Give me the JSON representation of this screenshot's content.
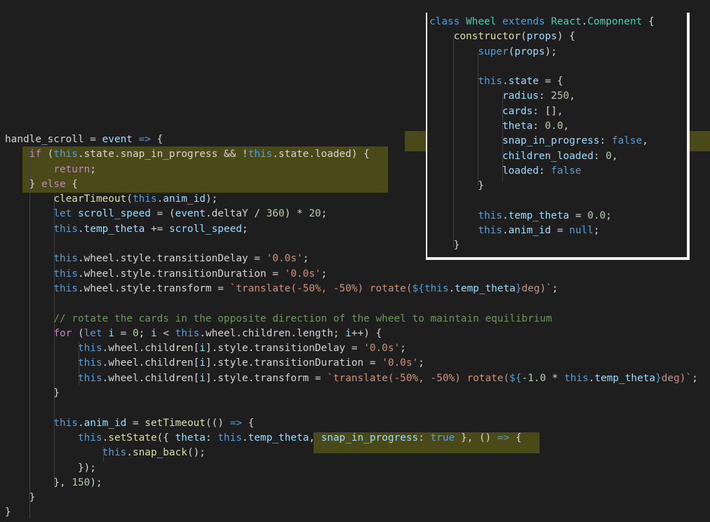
{
  "colors": {
    "background": "#1e1e1e",
    "highlight": "#707014",
    "keyword": "#569cd6",
    "control": "#c586c0",
    "type": "#4ec9b0",
    "function": "#dcdcaa",
    "variable": "#9cdcfe",
    "string": "#ce9178",
    "number": "#b5cea8",
    "comment": "#6a9955",
    "text": "#d4d4d4"
  },
  "main_code": {
    "lines": [
      [
        [
          "p",
          "handle_scroll"
        ],
        [
          "p",
          " = "
        ],
        [
          "v",
          "event"
        ],
        [
          "p",
          " "
        ],
        [
          "k",
          "=>"
        ],
        [
          "p",
          " {"
        ]
      ],
      [
        [
          "p",
          "    "
        ],
        [
          "c",
          "if"
        ],
        [
          "p",
          " ("
        ],
        [
          "k",
          "this"
        ],
        [
          "p",
          ".state.snap_in_progress && !"
        ],
        [
          "k",
          "this"
        ],
        [
          "p",
          ".state.loaded) {"
        ]
      ],
      [
        [
          "p",
          "        "
        ],
        [
          "c",
          "return"
        ],
        [
          "p",
          ";"
        ]
      ],
      [
        [
          "p",
          "    } "
        ],
        [
          "c",
          "else"
        ],
        [
          "p",
          " {"
        ]
      ],
      [
        [
          "p",
          "        "
        ],
        [
          "f",
          "clearTimeout"
        ],
        [
          "p",
          "("
        ],
        [
          "k",
          "this"
        ],
        [
          "p",
          "."
        ],
        [
          "v",
          "anim_id"
        ],
        [
          "p",
          ");"
        ]
      ],
      [
        [
          "p",
          "        "
        ],
        [
          "k",
          "let"
        ],
        [
          "p",
          " "
        ],
        [
          "v",
          "scroll_speed"
        ],
        [
          "p",
          " = ("
        ],
        [
          "v",
          "event"
        ],
        [
          "p",
          ".deltaY / "
        ],
        [
          "n",
          "360"
        ],
        [
          "p",
          ") * "
        ],
        [
          "n",
          "20"
        ],
        [
          "p",
          ";"
        ]
      ],
      [
        [
          "p",
          "        "
        ],
        [
          "k",
          "this"
        ],
        [
          "p",
          "."
        ],
        [
          "v",
          "temp_theta"
        ],
        [
          "p",
          " += "
        ],
        [
          "v",
          "scroll_speed"
        ],
        [
          "p",
          ";"
        ]
      ],
      [
        [
          "p",
          ""
        ]
      ],
      [
        [
          "p",
          "        "
        ],
        [
          "k",
          "this"
        ],
        [
          "p",
          ".wheel.style.transitionDelay = "
        ],
        [
          "s",
          "'0.0s'"
        ],
        [
          "p",
          ";"
        ]
      ],
      [
        [
          "p",
          "        "
        ],
        [
          "k",
          "this"
        ],
        [
          "p",
          ".wheel.style.transitionDuration = "
        ],
        [
          "s",
          "'0.0s'"
        ],
        [
          "p",
          ";"
        ]
      ],
      [
        [
          "p",
          "        "
        ],
        [
          "k",
          "this"
        ],
        [
          "p",
          ".wheel.style.transform = "
        ],
        [
          "s",
          "`translate(-50%, -50%) rotate("
        ],
        [
          "k",
          "${"
        ],
        [
          "k",
          "this"
        ],
        [
          "p",
          "."
        ],
        [
          "v",
          "temp_theta"
        ],
        [
          "k",
          "}"
        ],
        [
          "s",
          "deg)`"
        ],
        [
          "p",
          ";"
        ]
      ],
      [
        [
          "p",
          ""
        ]
      ],
      [
        [
          "p",
          "        "
        ],
        [
          "m",
          "// rotate the cards in the opposite direction of the wheel to maintain equilibrium"
        ]
      ],
      [
        [
          "p",
          "        "
        ],
        [
          "c",
          "for"
        ],
        [
          "p",
          " ("
        ],
        [
          "k",
          "let"
        ],
        [
          "p",
          " "
        ],
        [
          "v",
          "i"
        ],
        [
          "p",
          " = "
        ],
        [
          "n",
          "0"
        ],
        [
          "p",
          "; "
        ],
        [
          "v",
          "i"
        ],
        [
          "p",
          " < "
        ],
        [
          "k",
          "this"
        ],
        [
          "p",
          ".wheel.children.length; "
        ],
        [
          "v",
          "i"
        ],
        [
          "p",
          "++) {"
        ]
      ],
      [
        [
          "p",
          "            "
        ],
        [
          "k",
          "this"
        ],
        [
          "p",
          ".wheel.children["
        ],
        [
          "v",
          "i"
        ],
        [
          "p",
          "].style.transitionDelay = "
        ],
        [
          "s",
          "'0.0s'"
        ],
        [
          "p",
          ";"
        ]
      ],
      [
        [
          "p",
          "            "
        ],
        [
          "k",
          "this"
        ],
        [
          "p",
          ".wheel.children["
        ],
        [
          "v",
          "i"
        ],
        [
          "p",
          "].style.transitionDuration = "
        ],
        [
          "s",
          "'0.0s'"
        ],
        [
          "p",
          ";"
        ]
      ],
      [
        [
          "p",
          "            "
        ],
        [
          "k",
          "this"
        ],
        [
          "p",
          ".wheel.children["
        ],
        [
          "v",
          "i"
        ],
        [
          "p",
          "].style.transform = "
        ],
        [
          "s",
          "`translate(-50%, -50%) rotate("
        ],
        [
          "k",
          "${"
        ],
        [
          "n",
          "-1.0"
        ],
        [
          "p",
          " * "
        ],
        [
          "k",
          "this"
        ],
        [
          "p",
          "."
        ],
        [
          "v",
          "temp_theta"
        ],
        [
          "k",
          "}"
        ],
        [
          "s",
          "deg)`"
        ],
        [
          "p",
          ";"
        ]
      ],
      [
        [
          "p",
          "        }"
        ]
      ],
      [
        [
          "p",
          ""
        ]
      ],
      [
        [
          "p",
          "        "
        ],
        [
          "k",
          "this"
        ],
        [
          "p",
          "."
        ],
        [
          "v",
          "anim_id"
        ],
        [
          "p",
          " = "
        ],
        [
          "f",
          "setTimeout"
        ],
        [
          "p",
          "(() "
        ],
        [
          "k",
          "=>"
        ],
        [
          "p",
          " {"
        ]
      ],
      [
        [
          "p",
          "            "
        ],
        [
          "k",
          "this"
        ],
        [
          "p",
          "."
        ],
        [
          "f",
          "setState"
        ],
        [
          "p",
          "({ "
        ],
        [
          "v",
          "theta"
        ],
        [
          "p",
          ": "
        ],
        [
          "k",
          "this"
        ],
        [
          "p",
          "."
        ],
        [
          "v",
          "temp_theta"
        ],
        [
          "p",
          ", "
        ],
        [
          "v",
          "snap_in_progress"
        ],
        [
          "p",
          ": "
        ],
        [
          "k",
          "true"
        ],
        [
          "p",
          " }, () "
        ],
        [
          "k",
          "=>"
        ],
        [
          "p",
          " {"
        ]
      ],
      [
        [
          "p",
          "                "
        ],
        [
          "k",
          "this"
        ],
        [
          "p",
          "."
        ],
        [
          "f",
          "snap_back"
        ],
        [
          "p",
          "();"
        ]
      ],
      [
        [
          "p",
          "            });"
        ]
      ],
      [
        [
          "p",
          "        }, "
        ],
        [
          "n",
          "150"
        ],
        [
          "p",
          ");"
        ]
      ],
      [
        [
          "p",
          "    }"
        ]
      ],
      [
        [
          "p",
          "}"
        ]
      ]
    ]
  },
  "panel_code": {
    "lines": [
      [
        [
          "k",
          "class"
        ],
        [
          "p",
          " "
        ],
        [
          "t",
          "Wheel"
        ],
        [
          "p",
          " "
        ],
        [
          "k",
          "extends"
        ],
        [
          "p",
          " "
        ],
        [
          "t",
          "React"
        ],
        [
          "p",
          "."
        ],
        [
          "t",
          "Component"
        ],
        [
          "p",
          " {"
        ]
      ],
      [
        [
          "p",
          "    "
        ],
        [
          "f",
          "constructor"
        ],
        [
          "p",
          "("
        ],
        [
          "v",
          "props"
        ],
        [
          "p",
          ") {"
        ]
      ],
      [
        [
          "p",
          "        "
        ],
        [
          "k",
          "super"
        ],
        [
          "p",
          "("
        ],
        [
          "v",
          "props"
        ],
        [
          "p",
          ");"
        ]
      ],
      [
        [
          "p",
          ""
        ]
      ],
      [
        [
          "p",
          "        "
        ],
        [
          "k",
          "this"
        ],
        [
          "p",
          "."
        ],
        [
          "v",
          "state"
        ],
        [
          "p",
          " = {"
        ]
      ],
      [
        [
          "p",
          "            "
        ],
        [
          "v",
          "radius"
        ],
        [
          "p",
          ": "
        ],
        [
          "n",
          "250"
        ],
        [
          "p",
          ","
        ]
      ],
      [
        [
          "p",
          "            "
        ],
        [
          "v",
          "cards"
        ],
        [
          "p",
          ": [],"
        ]
      ],
      [
        [
          "p",
          "            "
        ],
        [
          "v",
          "theta"
        ],
        [
          "p",
          ": "
        ],
        [
          "n",
          "0.0"
        ],
        [
          "p",
          ","
        ]
      ],
      [
        [
          "p",
          "            "
        ],
        [
          "v",
          "snap_in_progress"
        ],
        [
          "p",
          ": "
        ],
        [
          "k",
          "false"
        ],
        [
          "p",
          ","
        ]
      ],
      [
        [
          "p",
          "            "
        ],
        [
          "v",
          "children_loaded"
        ],
        [
          "p",
          ": "
        ],
        [
          "n",
          "0"
        ],
        [
          "p",
          ","
        ]
      ],
      [
        [
          "p",
          "            "
        ],
        [
          "v",
          "loaded"
        ],
        [
          "p",
          ": "
        ],
        [
          "k",
          "false"
        ]
      ],
      [
        [
          "p",
          "        }"
        ]
      ],
      [
        [
          "p",
          ""
        ]
      ],
      [
        [
          "p",
          "        "
        ],
        [
          "k",
          "this"
        ],
        [
          "p",
          "."
        ],
        [
          "v",
          "temp_theta"
        ],
        [
          "p",
          " = "
        ],
        [
          "n",
          "0.0"
        ],
        [
          "p",
          ";"
        ]
      ],
      [
        [
          "p",
          "        "
        ],
        [
          "k",
          "this"
        ],
        [
          "p",
          "."
        ],
        [
          "v",
          "anim_id"
        ],
        [
          "p",
          " = "
        ],
        [
          "k",
          "null"
        ],
        [
          "p",
          ";"
        ]
      ],
      [
        [
          "p",
          "    }"
        ]
      ]
    ]
  }
}
